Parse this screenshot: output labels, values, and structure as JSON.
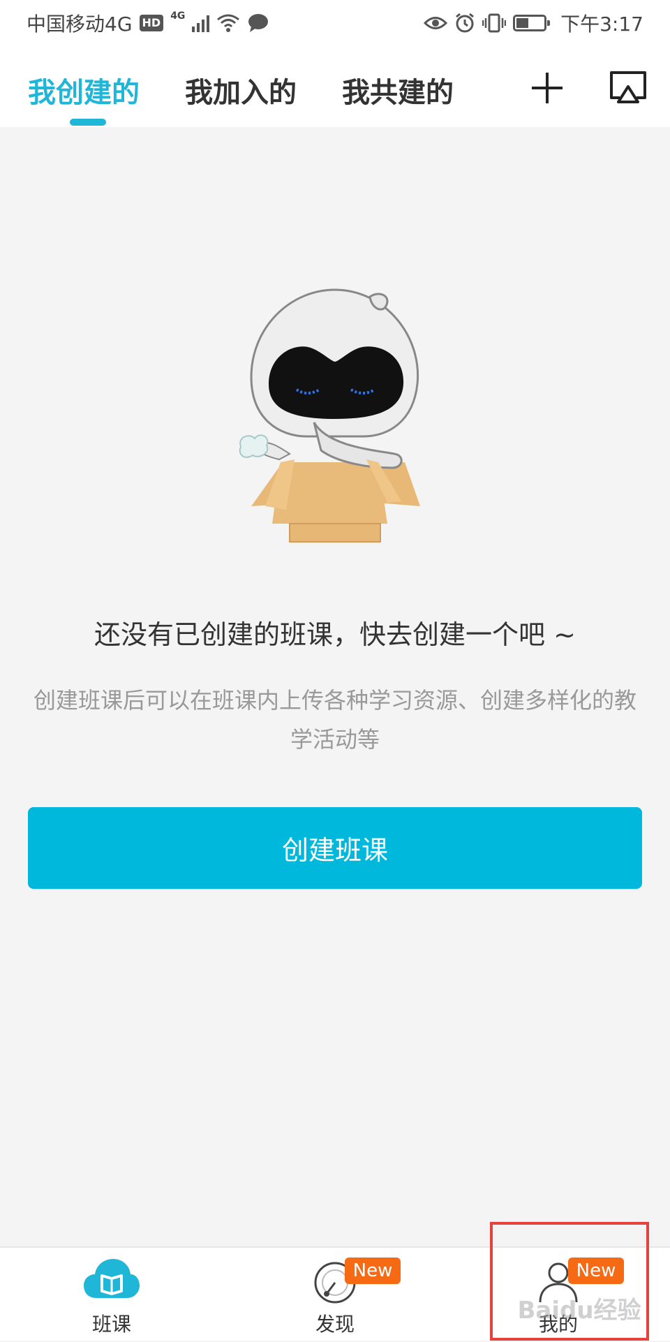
{
  "status_bar": {
    "carrier": "中国移动4G",
    "hd": "HD",
    "network": "4G",
    "time": "下午3:17"
  },
  "header": {
    "tabs": [
      {
        "label": "我创建的",
        "active": true
      },
      {
        "label": "我加入的",
        "active": false
      },
      {
        "label": "我共建的",
        "active": false
      }
    ],
    "add_icon": "plus-icon",
    "screen_icon": "screen-cast-icon"
  },
  "empty_state": {
    "title": "还没有已创建的班课，快去创建一个吧 ~",
    "description": "创建班课后可以在班课内上传各种学习资源、创建多样化的教学活动等",
    "button_label": "创建班课"
  },
  "bottom_nav": {
    "items": [
      {
        "label": "班课",
        "icon": "cloud-book-icon",
        "badge": ""
      },
      {
        "label": "发现",
        "icon": "compass-icon",
        "badge": "New"
      },
      {
        "label": "我的",
        "icon": "person-icon",
        "badge": "New"
      }
    ]
  },
  "colors": {
    "accent": "#1fb6d8",
    "button": "#00b8db",
    "badge": "#f56a13",
    "highlight": "#e8403b"
  },
  "watermark": "Baidu经验"
}
